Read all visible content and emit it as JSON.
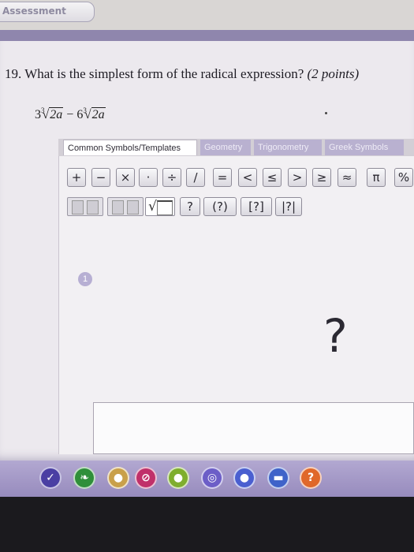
{
  "header": {
    "tab_label": "Assessment"
  },
  "question": {
    "number": "19.",
    "text": "What is the simplest form of the radical expression?",
    "points": "(2 points)",
    "expression": {
      "coef1": "3",
      "index1": "3",
      "radicand1": "2a",
      "operator": "−",
      "coef2": "6",
      "index2": "3",
      "radicand2": "2a"
    }
  },
  "editor": {
    "tabs": [
      {
        "label": "Common Symbols/Templates",
        "active": true
      },
      {
        "label": "Geometry",
        "active": false
      },
      {
        "label": "Trigonometry",
        "active": false
      },
      {
        "label": "Greek Symbols",
        "active": false
      }
    ],
    "symbols_row1": [
      "+",
      "−",
      "×",
      "·",
      "÷",
      "/",
      "=",
      "<",
      "≤",
      ">",
      "≥",
      "≈",
      "π",
      "%"
    ],
    "symbols_row2": [
      "?",
      "(?)",
      "[?]",
      "|?|"
    ]
  },
  "answer": {
    "badge": "1",
    "placeholder_glyph": "?"
  },
  "toolbar": {
    "tools": [
      {
        "icon": "check-icon",
        "glyph": "✓",
        "color": "#4a3fa3"
      },
      {
        "icon": "leaf-icon",
        "glyph": "❧",
        "color": "#2f8f3a"
      },
      {
        "icon": "globe-icon",
        "glyph": "●",
        "color": "#c9a04a"
      },
      {
        "icon": "no-icon",
        "glyph": "⊘",
        "color": "#c0306a"
      },
      {
        "icon": "info-icon",
        "glyph": "●",
        "color": "#7fae2e"
      },
      {
        "icon": "target-icon",
        "glyph": "◎",
        "color": "#6c5ec7"
      },
      {
        "icon": "chat-icon",
        "glyph": "●",
        "color": "#4a5fd0"
      },
      {
        "icon": "notepad-icon",
        "glyph": "▬",
        "color": "#3f63c9"
      },
      {
        "icon": "help-icon",
        "glyph": "?",
        "color": "#e0682a"
      }
    ]
  }
}
